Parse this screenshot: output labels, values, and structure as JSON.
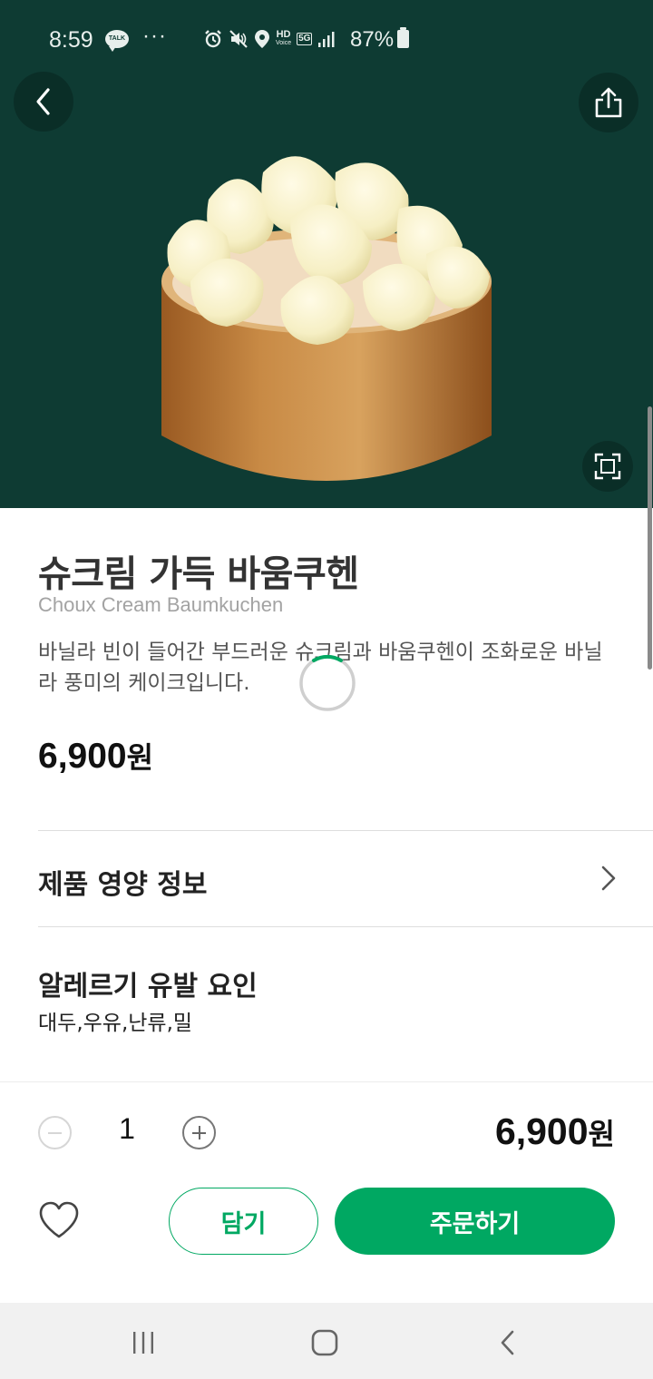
{
  "status_bar": {
    "time": "8:59",
    "talk_badge": "TALK",
    "more": "···",
    "hd_label": "HD",
    "hd_sub": "Voice",
    "network": "5G",
    "battery": "87%"
  },
  "icons": {
    "back": "chevron-left-icon",
    "share": "share-icon",
    "zoom": "fullscreen-icon",
    "heart": "heart-icon"
  },
  "colors": {
    "hero_bg": "#0e3b33",
    "accent": "#00a862"
  },
  "product": {
    "name": "슈크림 가득 바움쿠헨",
    "name_en": "Choux Cream Baumkuchen",
    "description": "바닐라 빈이 들어간 부드러운 슈크림과 바움쿠헨이 조화로운 바닐라 풍미의 케이크입니다.",
    "price": "6,900",
    "currency": "원"
  },
  "nutrition": {
    "label": "제품 영양 정보"
  },
  "allergy": {
    "title": "알레르기 유발 요인",
    "items": "대두,우유,난류,밀"
  },
  "order": {
    "quantity": "1",
    "total": "6,900",
    "currency": "원",
    "cart_label": "담기",
    "order_label": "주문하기"
  }
}
